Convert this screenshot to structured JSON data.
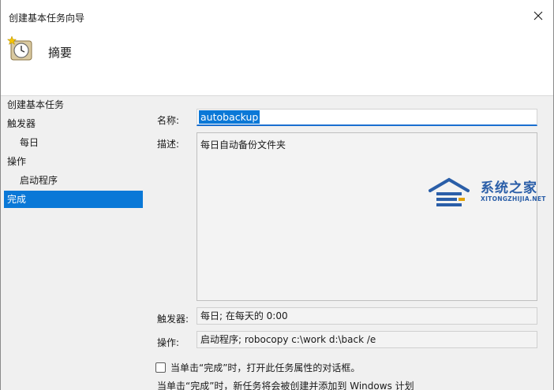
{
  "window": {
    "title": "创建基本任务向导"
  },
  "header": {
    "title": "摘要"
  },
  "sidebar": {
    "items": [
      {
        "label": "创建基本任务"
      },
      {
        "label": "触发器"
      },
      {
        "label": "每日"
      },
      {
        "label": "操作"
      },
      {
        "label": "启动程序"
      },
      {
        "label": "完成"
      }
    ]
  },
  "form": {
    "name_label": "名称:",
    "name_value": "autobackup",
    "desc_label": "描述:",
    "desc_value": "每日自动备份文件夹",
    "trigger_label": "触发器:",
    "trigger_value": "每日; 在每天的 0:00",
    "action_label": "操作:",
    "action_value": "启动程序; robocopy c:\\work d:\\back /e",
    "checkbox_label": "当单击“完成”时，打开此任务属性的对话框。",
    "note": "当单击“完成”时，新任务将会被创建并添加到 Windows 计划"
  },
  "watermark": {
    "text": "系统之家",
    "url": "XITONGZHIJIA.NET"
  },
  "colors": {
    "selection": "#0a78d7",
    "watermark": "#2a5ea8"
  }
}
